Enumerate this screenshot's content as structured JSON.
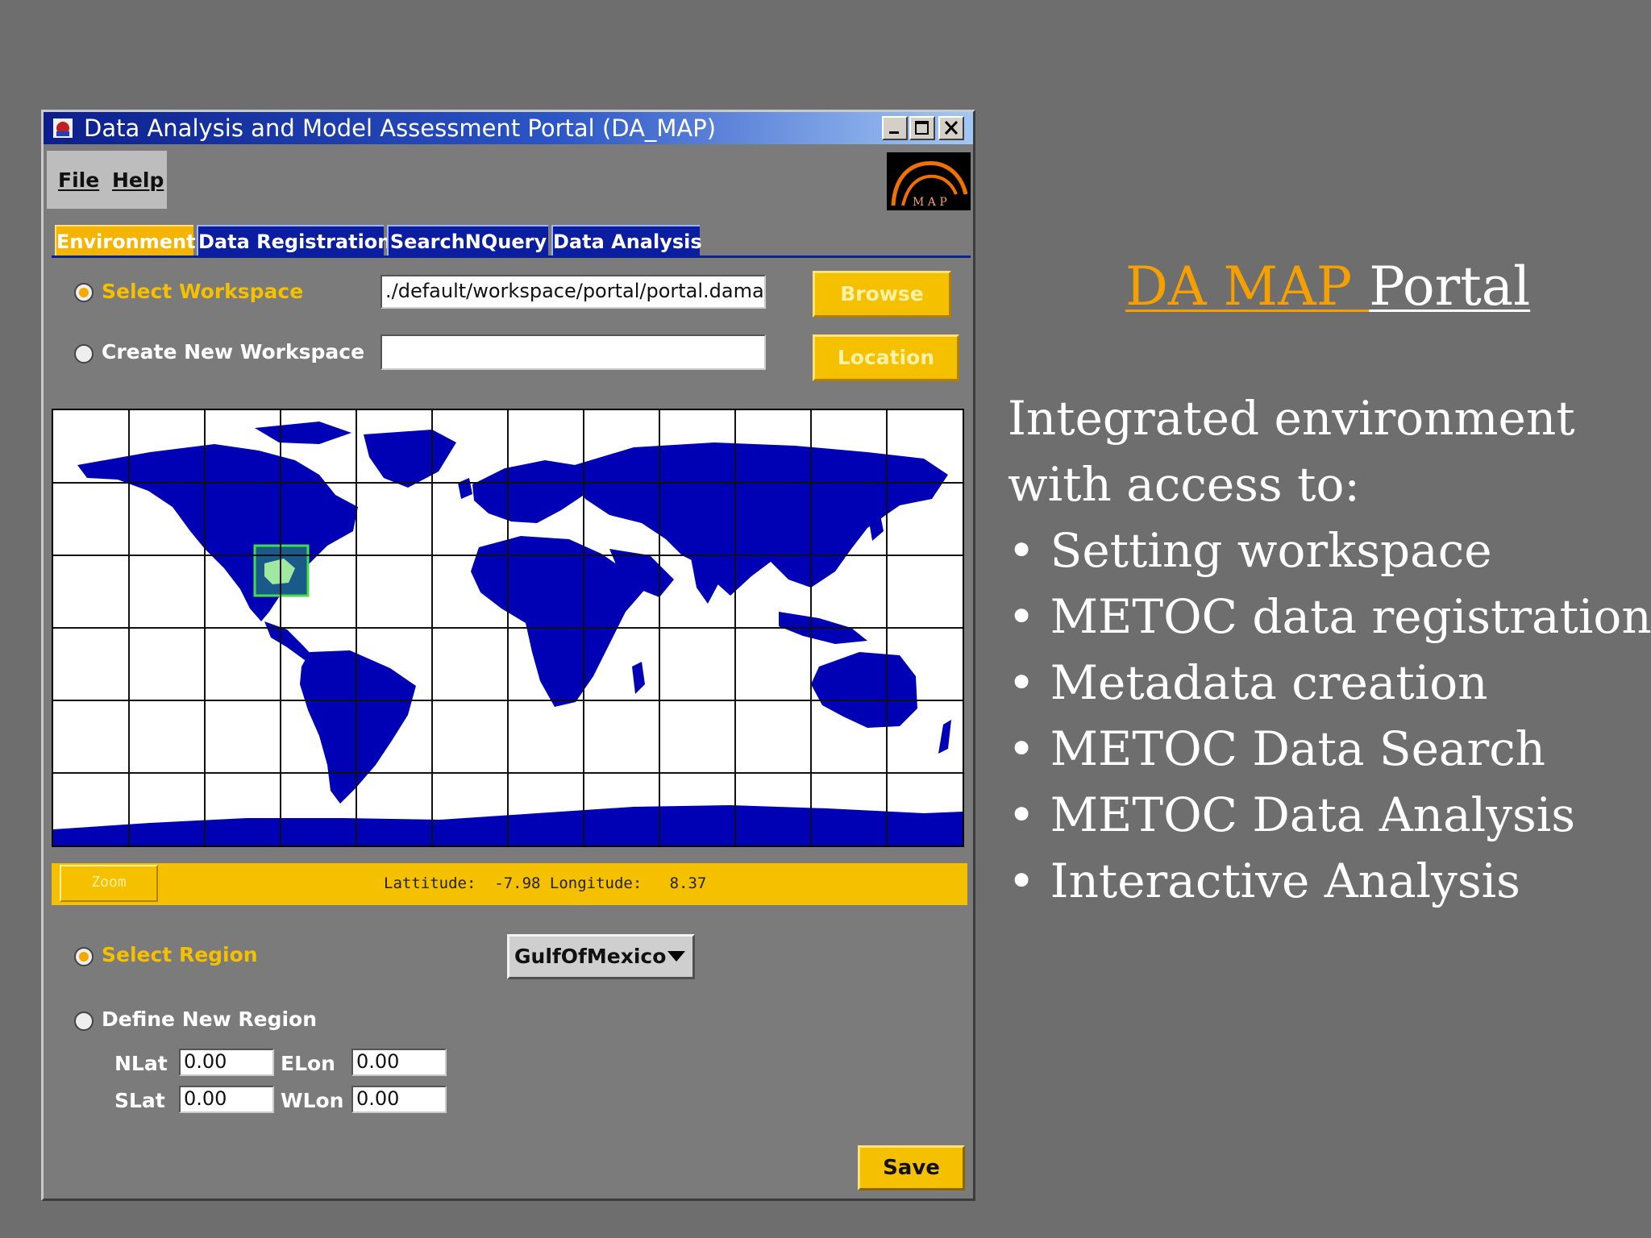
{
  "window": {
    "title": "Data Analysis and Model Assessment Portal (DA_MAP)",
    "controls": {
      "minimize": "minimize-icon",
      "maximize": "maximize-icon",
      "close": "close-icon"
    }
  },
  "menu": {
    "file": "File",
    "help": "Help"
  },
  "logo": {
    "text": "M A P"
  },
  "tabs": [
    "Environment",
    "Data Registration",
    "SearchNQuery",
    "Data Analysis"
  ],
  "active_tab": "Environment",
  "workspace": {
    "select_label": "Select Workspace",
    "select_value": "./default/workspace/portal/portal.damap",
    "create_label": "Create New Workspace",
    "create_value": "",
    "browse_label": "Browse",
    "location_label": "Location"
  },
  "map": {
    "zoom_label": "Zoom",
    "coords_text": "Lattitude:  -7.98 Longitude:   8.37"
  },
  "region": {
    "select_label": "Select Region",
    "selected": "GulfOfMexico",
    "define_label": "Define New Region",
    "nlat_label": "NLat",
    "nlat": "0.00",
    "elon_label": "ELon",
    "elon": "0.00",
    "slat_label": "SLat",
    "slat": "0.00",
    "wlon_label": "WLon",
    "wlon": "0.00"
  },
  "save_label": "Save",
  "slide": {
    "title_part1": "DA MAP ",
    "title_part2": "Portal",
    "intro": "Integrated environment with access to:",
    "bullets": [
      "Setting workspace",
      "METOC data registration",
      "Metadata creation",
      "METOC Data Search",
      "METOC Data Analysis",
      "Interactive Analysis"
    ]
  },
  "colors": {
    "accent": "#f5c000",
    "tab_blue": "#0b1ea0",
    "land": "#0000b4",
    "title_orange": "#f5a000"
  }
}
